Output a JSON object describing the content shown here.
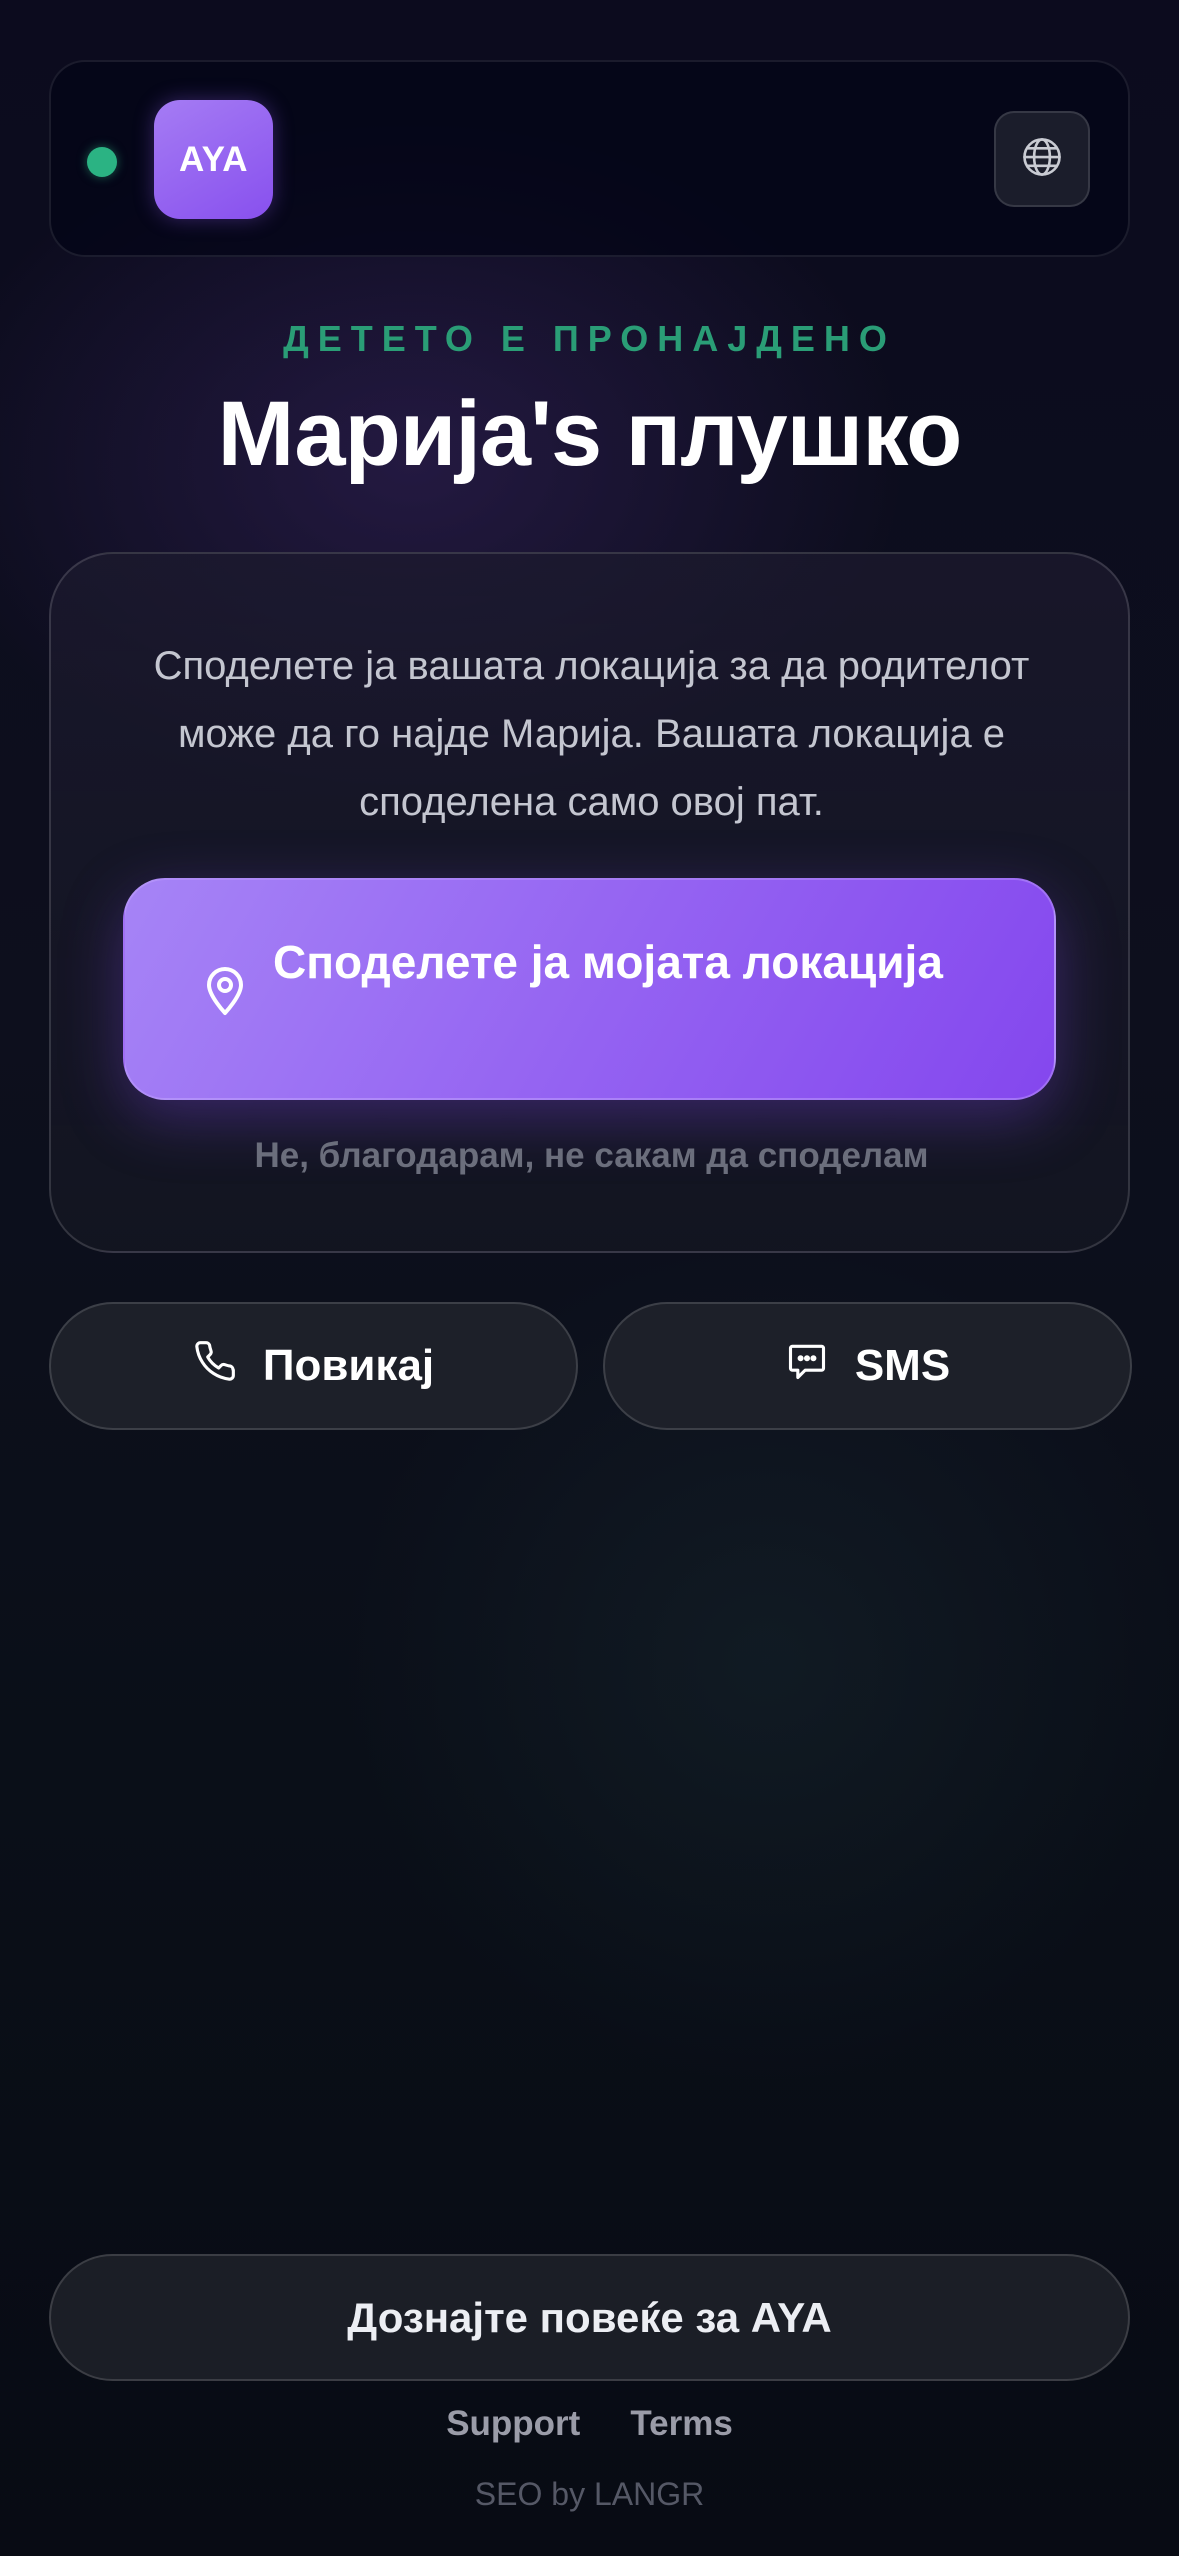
{
  "header": {
    "logo_text": "AYA",
    "status_color": "#2bb383",
    "language_icon": "globe-icon"
  },
  "hero": {
    "eyebrow": "ДЕТЕТО Е ПРОНАЈДЕНО",
    "title": "Марија's плушко"
  },
  "share": {
    "description": "Споделете ја вашата локација за да родителот може да го најде Марија. Вашата локација е споделена само овој пат.",
    "button_label": "Споделете ја мојата локација",
    "button_icon": "location-pin-icon",
    "decline_label": "Не, благодарам, не сакам да споделам",
    "accent_color": "#8c55ef"
  },
  "actions": {
    "call_label": "Повикај",
    "call_icon": "phone-icon",
    "sms_label": "SMS",
    "sms_icon": "chat-bubble-icon"
  },
  "footer": {
    "learn_more_label": "Дознајте повеќе за AYA",
    "support_label": "Support",
    "terms_label": "Terms",
    "credit": "SEO by LANGR"
  }
}
